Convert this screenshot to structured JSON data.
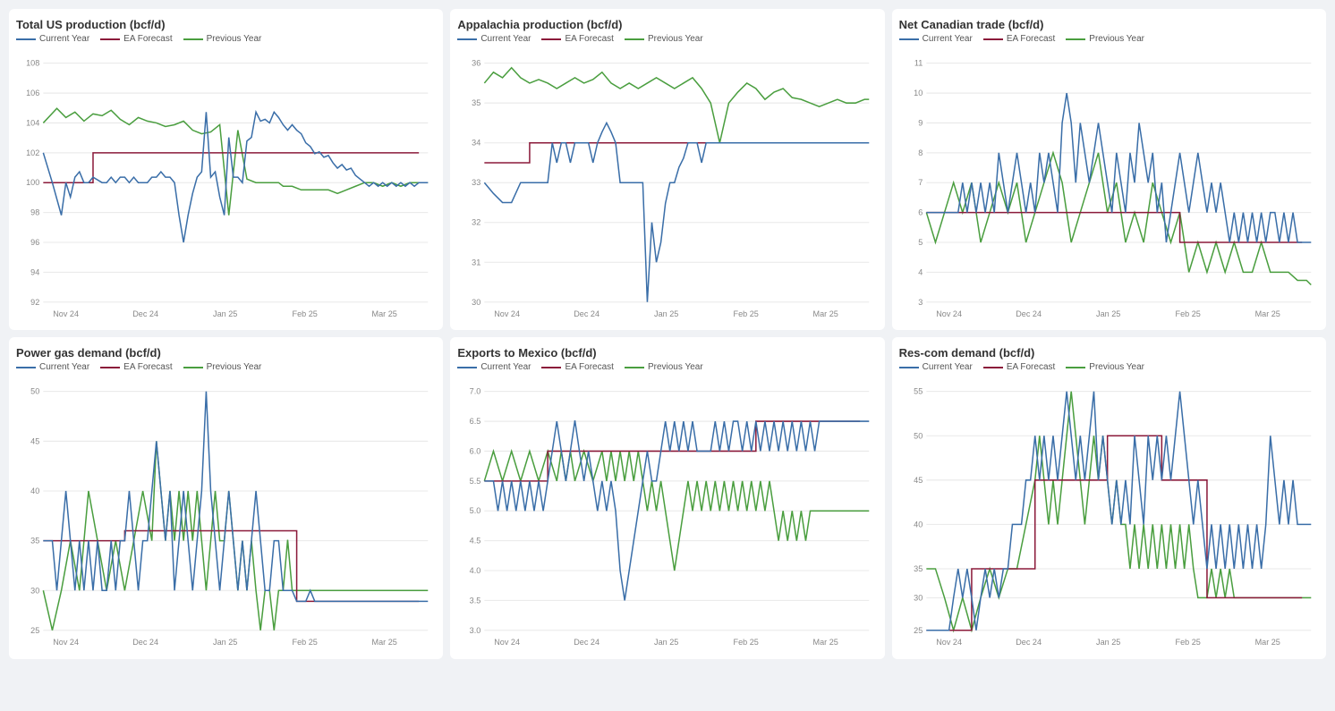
{
  "charts": [
    {
      "id": "total-us-production",
      "title": "Total US production (bcf/d)",
      "yMin": 92,
      "yMax": 108,
      "yTicks": [
        92,
        94,
        96,
        98,
        100,
        102,
        104,
        106,
        108
      ],
      "xLabels": [
        "Nov 24",
        "Dec 24",
        "Jan 25",
        "Feb 25",
        "Mar 25"
      ],
      "legend": [
        "Current Year",
        "EA Forecast",
        "Previous Year"
      ],
      "colors": {
        "current": "#3a6ea8",
        "forecast": "#8b1a3a",
        "previous": "#4a9e3f"
      }
    },
    {
      "id": "appalachia-production",
      "title": "Appalachia production (bcf/d)",
      "yMin": 30,
      "yMax": 36,
      "yTicks": [
        30,
        31,
        32,
        33,
        34,
        35,
        36
      ],
      "xLabels": [
        "Nov 24",
        "Dec 24",
        "Jan 25",
        "Feb 25",
        "Mar 25"
      ],
      "legend": [
        "Current Year",
        "EA Forecast",
        "Previous Year"
      ],
      "colors": {
        "current": "#3a6ea8",
        "forecast": "#8b1a3a",
        "previous": "#4a9e3f"
      }
    },
    {
      "id": "net-canadian-trade",
      "title": "Net Canadian trade (bcf/d)",
      "yMin": 3,
      "yMax": 11,
      "yTicks": [
        3,
        4,
        5,
        6,
        7,
        8,
        9,
        10,
        11
      ],
      "xLabels": [
        "Nov 24",
        "Dec 24",
        "Jan 25",
        "Feb 25",
        "Mar 25"
      ],
      "legend": [
        "Current Year",
        "EA Forecast",
        "Previous Year"
      ],
      "colors": {
        "current": "#3a6ea8",
        "forecast": "#8b1a3a",
        "previous": "#4a9e3f"
      }
    },
    {
      "id": "power-gas-demand",
      "title": "Power gas demand (bcf/d)",
      "yMin": 25,
      "yMax": 50,
      "yTicks": [
        25,
        30,
        35,
        40,
        45,
        50
      ],
      "xLabels": [
        "Nov 24",
        "Dec 24",
        "Jan 25",
        "Feb 25",
        "Mar 25"
      ],
      "legend": [
        "Current Year",
        "EA Forecast",
        "Previous Year"
      ],
      "colors": {
        "current": "#3a6ea8",
        "forecast": "#8b1a3a",
        "previous": "#4a9e3f"
      }
    },
    {
      "id": "exports-to-mexico",
      "title": "Exports to Mexico (bcf/d)",
      "yMin": 3.0,
      "yMax": 7.0,
      "yTicks": [
        3.0,
        3.5,
        4.0,
        4.5,
        5.0,
        5.5,
        6.0,
        6.5,
        7.0
      ],
      "xLabels": [
        "Nov 24",
        "Dec 24",
        "Jan 25",
        "Feb 25",
        "Mar 25"
      ],
      "legend": [
        "Current Year",
        "EA Forecast",
        "Previous Year"
      ],
      "colors": {
        "current": "#3a6ea8",
        "forecast": "#8b1a3a",
        "previous": "#4a9e3f"
      }
    },
    {
      "id": "res-com-demand",
      "title": "Res-com demand (bcf/d)",
      "yMin": 25,
      "yMax": 55,
      "yTicks": [
        25,
        30,
        35,
        40,
        45,
        50,
        55
      ],
      "xLabels": [
        "Nov 24",
        "Dec 24",
        "Jan 25",
        "Feb 25",
        "Mar 25"
      ],
      "legend": [
        "Current Year",
        "EA Forecast",
        "Previous Year"
      ],
      "colors": {
        "current": "#3a6ea8",
        "forecast": "#8b1a3a",
        "previous": "#4a9e3f"
      }
    }
  ],
  "legend": {
    "current_year": "Current Year",
    "ea_forecast": "EA Forecast",
    "previous_year": "Previous Year"
  }
}
